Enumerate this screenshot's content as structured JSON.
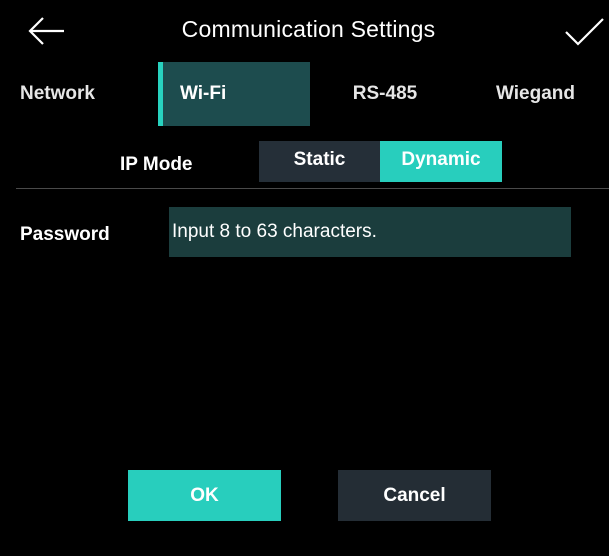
{
  "header": {
    "title": "Communication Settings",
    "back_icon": "back-arrow-icon",
    "confirm_icon": "checkmark-icon"
  },
  "tabs": [
    {
      "label": "Network",
      "active": false
    },
    {
      "label": "Wi-Fi",
      "active": true
    },
    {
      "label": "RS-485",
      "active": false
    },
    {
      "label": "Wiegand",
      "active": false
    }
  ],
  "ip_mode": {
    "label": "IP Mode",
    "options": [
      "Static",
      "Dynamic"
    ],
    "selected": "Dynamic"
  },
  "password": {
    "label": "Password",
    "placeholder": "Input 8 to 63 characters."
  },
  "buttons": {
    "ok": "OK",
    "cancel": "Cancel"
  },
  "colors": {
    "accent": "#28cebd",
    "active_tab_bg": "#1d4c4e",
    "input_bg": "#1b3d3d",
    "inactive_button_bg": "#242d35",
    "background": "#000000"
  }
}
